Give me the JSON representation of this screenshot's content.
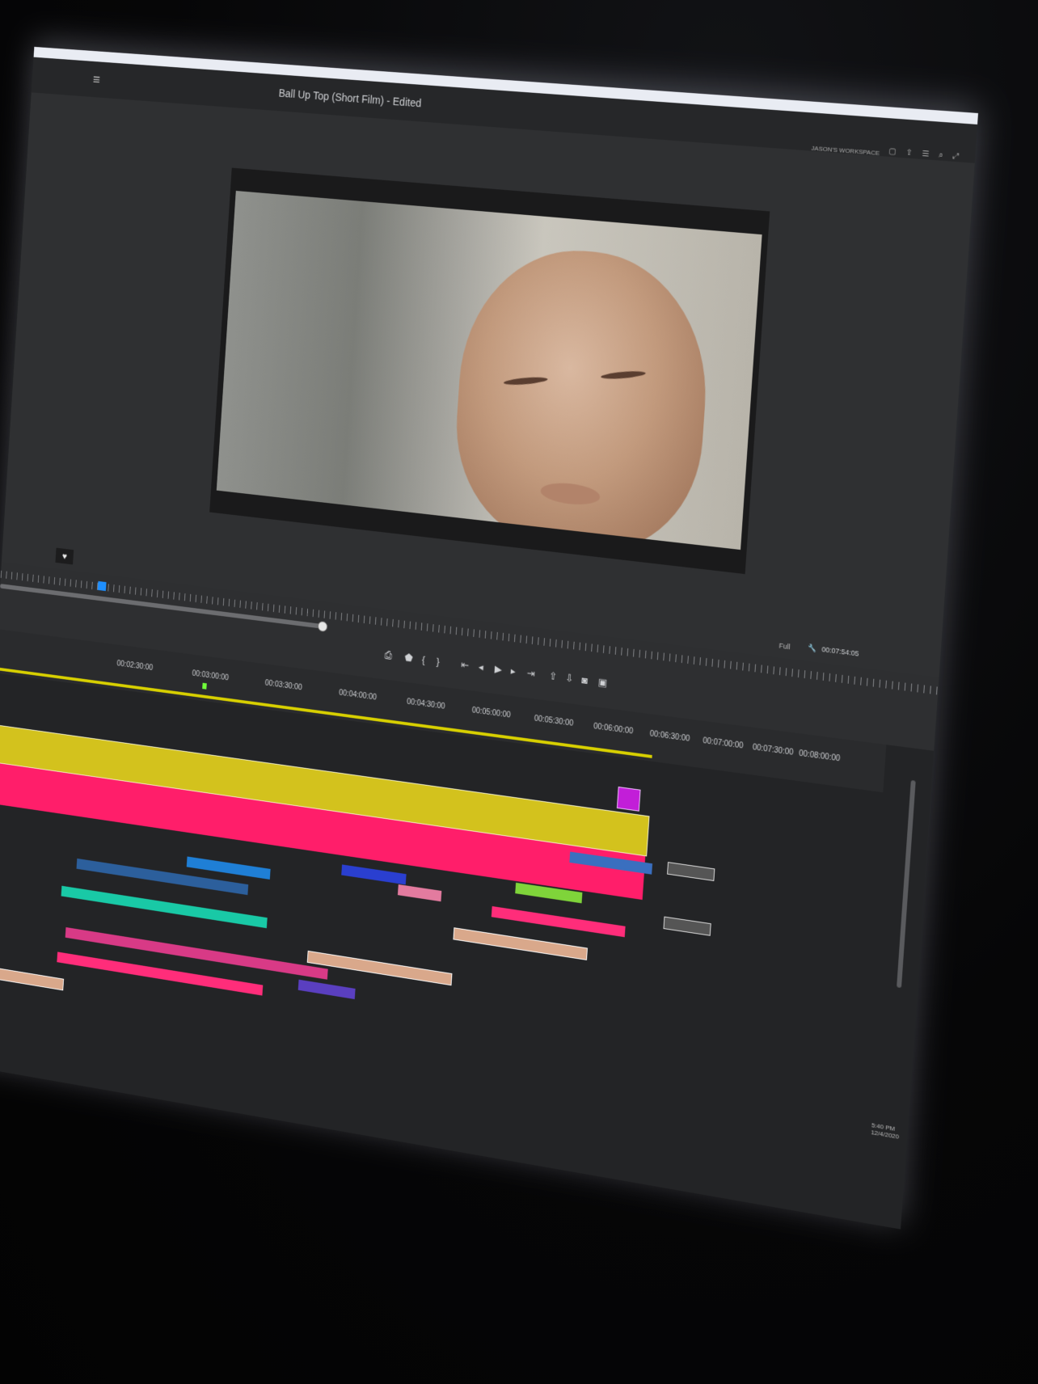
{
  "app": {
    "document_title": "Ball Up Top (Short Film) - Edited",
    "workspace_label": "JASON'S WORKSPACE"
  },
  "program_monitor": {
    "zoom": "Full",
    "timecode": "00:07:54:05"
  },
  "timeline": {
    "ruler_timecodes": [
      "00:02:30:00",
      "00:03:00:00",
      "00:03:30:00",
      "00:04:00:00",
      "00:04:30:00",
      "00:05:00:00",
      "00:05:30:00",
      "00:06:00:00",
      "00:06:30:00",
      "00:07:00:00",
      "00:07:30:00",
      "00:08:00:00"
    ]
  },
  "system_tray": {
    "time": "5:40 PM",
    "date": "12/4/2020"
  },
  "colors": {
    "work_area": "#d8d000",
    "yellow_clip": "#d3c21d",
    "red_clip": "#ff1e6a",
    "purple_clip": "#c21ed8",
    "playhead_marker": "#1e8fff"
  }
}
